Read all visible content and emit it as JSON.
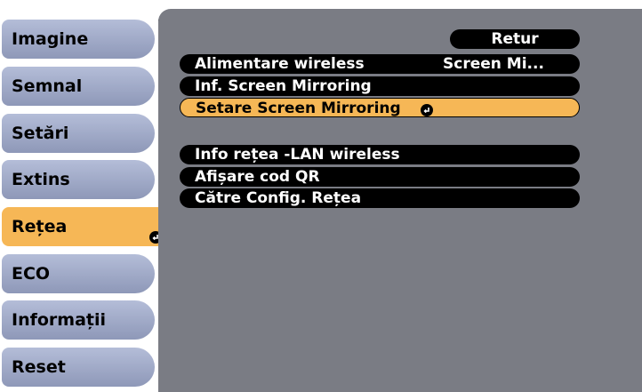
{
  "sidebar": {
    "items": [
      {
        "label": "Imagine"
      },
      {
        "label": "Semnal"
      },
      {
        "label": "Setări"
      },
      {
        "label": "Extins"
      },
      {
        "label": "Rețea",
        "selected": true
      },
      {
        "label": "ECO"
      },
      {
        "label": "Informații"
      },
      {
        "label": "Reset"
      }
    ]
  },
  "panel": {
    "return_label": "Retur",
    "rows": [
      {
        "label": "Alimentare wireless",
        "value": "Screen Mi..."
      },
      {
        "label": "Inf. Screen Mirroring"
      },
      {
        "label": "Setare Screen Mirroring",
        "selected": true
      },
      {
        "label": "Info rețea -LAN wireless"
      },
      {
        "label": "Afișare cod QR"
      },
      {
        "label": "Către Config. Rețea"
      }
    ]
  },
  "colors": {
    "menu_item": "#9aa4c6",
    "selected": "#f6b756",
    "panel_bg": "#7a7c84",
    "row_bg": "#000000"
  },
  "icons": {
    "enter": "enter-icon"
  }
}
